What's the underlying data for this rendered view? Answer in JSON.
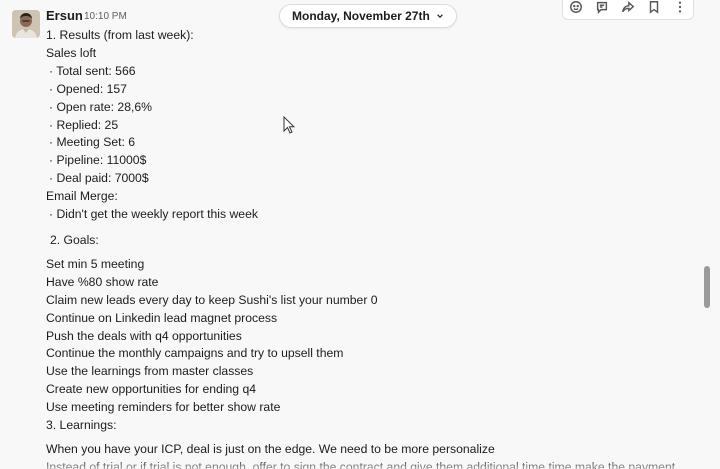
{
  "header": {
    "date_label": "Monday, November 27th"
  },
  "message": {
    "sender": "Ersun",
    "time": "10:10 PM",
    "lines": {
      "l1": "1. Results (from last week):",
      "l2": "Sales loft",
      "l3": "Total sent: 566",
      "l4": "Opened: 157",
      "l5": "Open rate: 28,6%",
      "l6": "Replied: 25",
      "l7": "Meeting Set: 6",
      "l8": "Pipeline: 11000$",
      "l9": "Deal paid: 7000$",
      "l10": "Email Merge:",
      "l11": "Didn't get the weekly report this week",
      "l12": "2. Goals:",
      "l13": "Set min 5 meeting",
      "l14": "Have  %80 show rate",
      "l15": "Claim new leads every day to keep Sushi's list your number 0",
      "l16": "Continue on Linkedin lead magnet process",
      "l17": "Push the deals with q4 opportunities",
      "l18": "Continue the monthly campaigns and try to upsell them",
      "l19": "Use the learnings from master classes",
      "l20": "Create new opportunities for ending q4",
      "l21": "Use meeting reminders for better show rate",
      "l22": "3. Learnings:",
      "l23": "When you have your ICP, deal is just on the edge. We need to be more personalize",
      "l24": "Instead of trial or if trial is not enough, offer to sign the contract and give them additional time time make the payment"
    }
  },
  "actions": {
    "icons": [
      "add-reaction-icon",
      "reply-in-thread-icon",
      "forward-icon",
      "bookmark-icon",
      "more-icon"
    ]
  },
  "colors": {
    "background": "#f8f8f8",
    "text": "#1d1c1d",
    "muted": "#616061"
  }
}
